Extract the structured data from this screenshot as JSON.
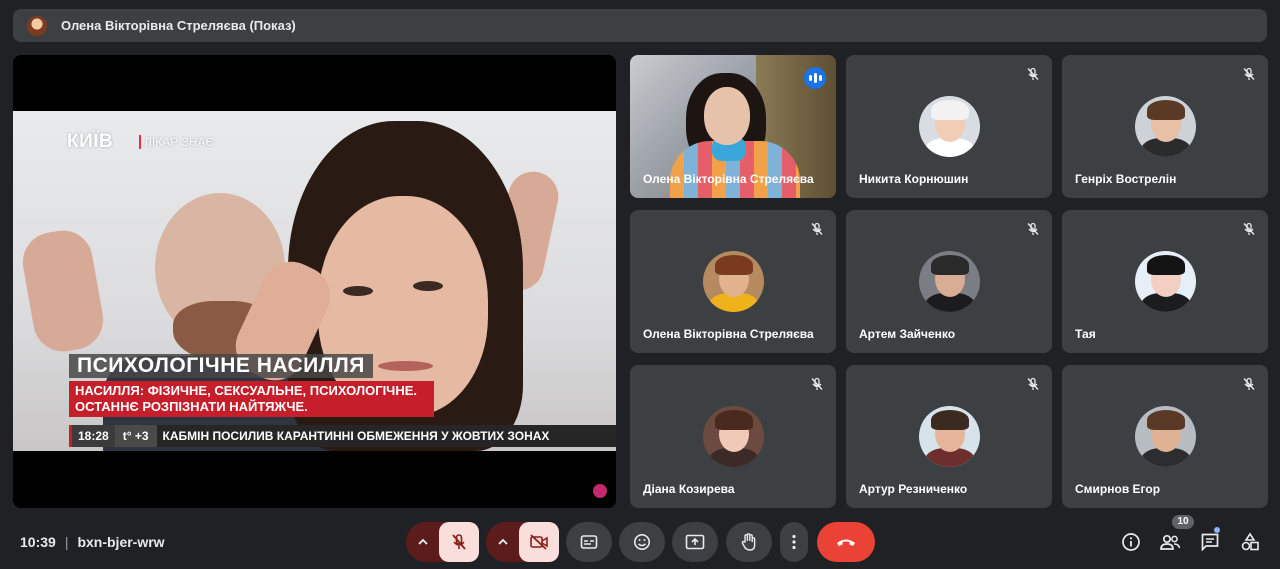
{
  "header": {
    "presenter_title": "Олена Вікторівна Стреляєва (Показ)"
  },
  "presentation": {
    "channel_logo": "КИЇВ",
    "channel_sub": "ЛІКАР ЗНАЄ",
    "headline": "ПСИХОЛОГІЧНЕ НАСИЛЛЯ",
    "subline_1": "НАСИЛЛЯ: ФІЗИЧНЕ, СЕКСУАЛЬНЕ, ПСИХОЛОГІЧНЕ.",
    "subline_2": "ОСТАННЄ РОЗПІЗНАТИ НАЙТЯЖЧЕ.",
    "ticker_time": "18:28",
    "ticker_temp": "t° +3",
    "ticker_text": "КАБМІН ПОСИЛИВ КАРАНТИННІ ОБМЕЖЕННЯ У ЖОВТИХ ЗОНАХ"
  },
  "participants": [
    {
      "name": "Олена Вікторівна Стреляєва",
      "video": true,
      "speaking": true
    },
    {
      "name": "Никита Корнюшин",
      "muted": true,
      "colors": {
        "bg": "#d8dde3",
        "skin": "#f0cdb4",
        "shirt": "#ffffff",
        "hair": "#f2f2f2"
      }
    },
    {
      "name": "Генріх Вострелін",
      "muted": true,
      "colors": {
        "bg": "#cdd2d8",
        "skin": "#e8c0a6",
        "shirt": "#2b2b2b",
        "hair": "#5a3a25"
      }
    },
    {
      "name": "Олена Вікторівна Стреляєва",
      "muted": true,
      "colors": {
        "bg": "#b58a5f",
        "skin": "#e2b28f",
        "shirt": "#f0b21a",
        "hair": "#7a3a1f"
      }
    },
    {
      "name": "Артем Зайченко",
      "muted": true,
      "colors": {
        "bg": "#7a7d84",
        "skin": "#d9ad95",
        "shirt": "#1c1c1e",
        "hair": "#2a2a2a"
      }
    },
    {
      "name": "Тая",
      "muted": true,
      "colors": {
        "bg": "#e6eef7",
        "skin": "#f2cfc0",
        "shirt": "#1c1c1e",
        "hair": "#141414"
      }
    },
    {
      "name": "Діана Козирева",
      "muted": true,
      "colors": {
        "bg": "#6d4a3f",
        "skin": "#f0c9b8",
        "shirt": "#3b2a25",
        "hair": "#4a2a1e"
      }
    },
    {
      "name": "Артур Резниченко",
      "muted": true,
      "colors": {
        "bg": "#d7e3ea",
        "skin": "#e6b49b",
        "shirt": "#6e2e2e",
        "hair": "#3a2a20"
      }
    },
    {
      "name": "Смирнов Егор",
      "muted": true,
      "colors": {
        "bg": "#b7bcc2",
        "skin": "#dfb293",
        "shirt": "#2d2d30",
        "hair": "#5a3a26"
      }
    }
  ],
  "bottombar": {
    "time": "10:39",
    "meeting_code": "bxn-bjer-wrw",
    "participant_count": "10"
  },
  "icons": {
    "mic_off": "mic-off-icon",
    "cam_off": "camera-off-icon",
    "captions": "closed-captions-icon",
    "emoji": "emoji-icon",
    "present": "present-screen-icon",
    "raise_hand": "raise-hand-icon",
    "more": "more-options-icon",
    "end_call": "end-call-icon",
    "info": "info-icon",
    "people": "people-icon",
    "chat": "chat-icon",
    "activities": "activities-icon"
  },
  "colors": {
    "end_call": "#ea4335",
    "speaking": "#1a73e8",
    "muted_control": "#f9dedc"
  }
}
